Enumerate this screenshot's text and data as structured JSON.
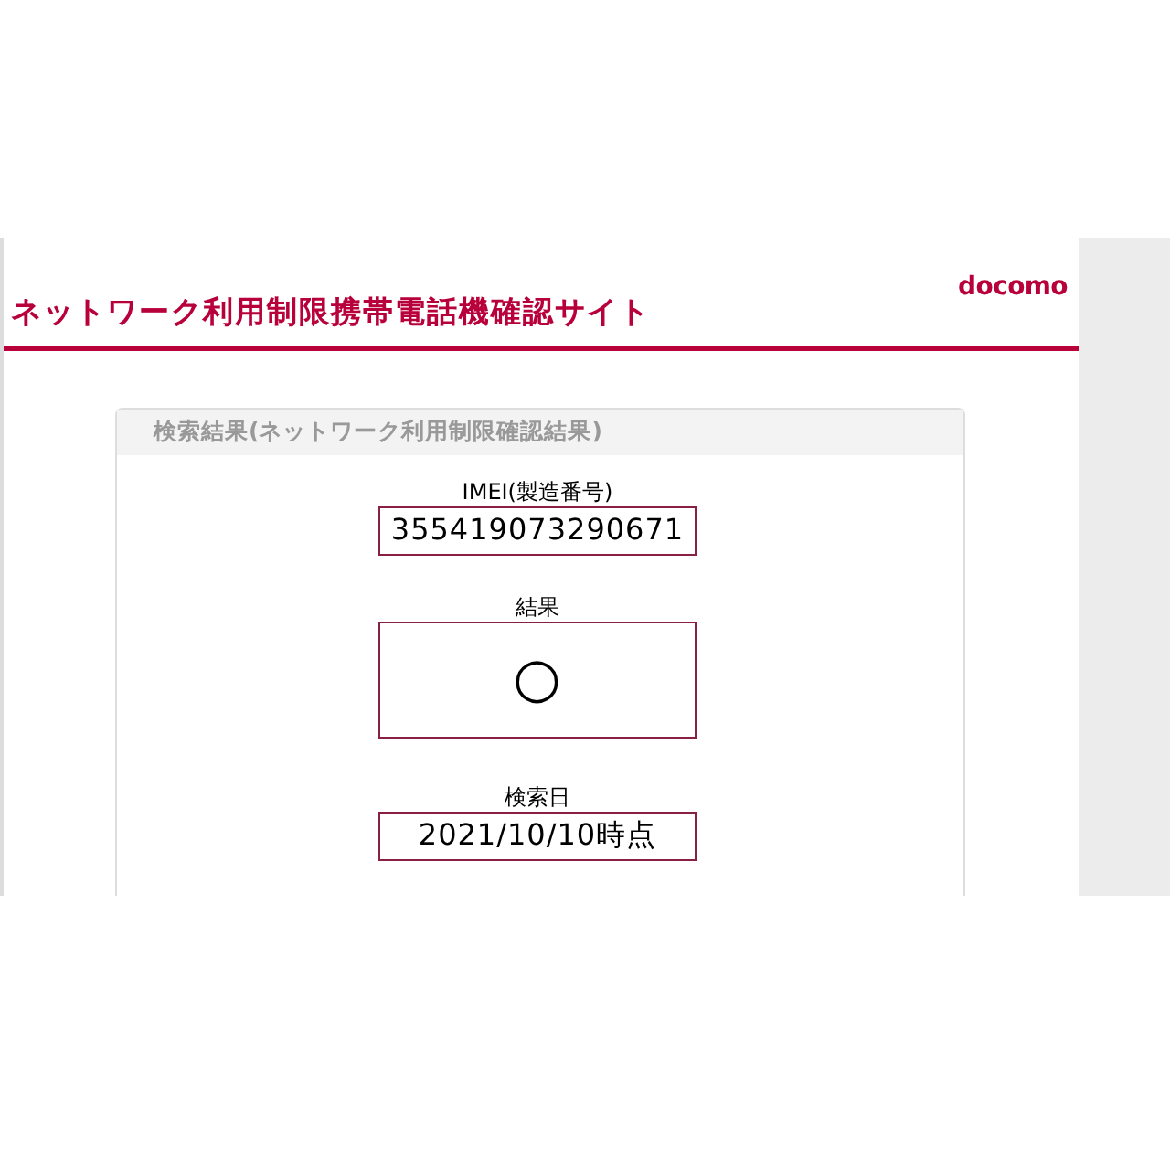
{
  "header": {
    "title": "ネットワーク利用制限携帯電話機確認サイト",
    "logo": "docomo"
  },
  "card": {
    "title": "検索結果(ネットワーク利用制限確認結果)",
    "fields": [
      {
        "label": "IMEI(製造番号)",
        "value": "355419073290671",
        "kind": "text"
      },
      {
        "label": "結果",
        "value": "○",
        "kind": "symbol"
      },
      {
        "label": "検索日",
        "value": "2021/10/10時点",
        "kind": "text"
      }
    ]
  }
}
